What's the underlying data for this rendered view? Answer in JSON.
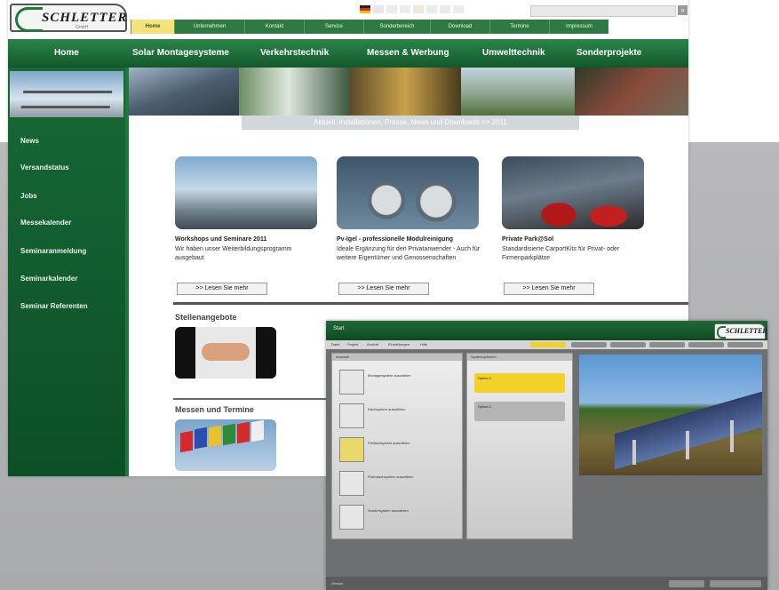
{
  "website": {
    "logo": {
      "name": "SCHLETTER",
      "sub": "GmbH"
    },
    "top_tabs": [
      "Home",
      "Unternehmen",
      "Kontakt",
      "Service",
      "Sonderbereich",
      "Download",
      "Termine",
      "Impressum"
    ],
    "main_nav": [
      "Home",
      "Solar Montagesysteme",
      "Verkehrstechnik",
      "Messen & Werbung",
      "Umwelttechnik",
      "Sonderprojekte"
    ],
    "sidebar": [
      "News",
      "Versandstatus",
      "Jobs",
      "Messekalender",
      "Seminaranmeldung",
      "Seminarkalender",
      "Seminar Referenten"
    ],
    "banner_caption": "Aktuell: Installationen, Presse, News und Downloads >> 2011",
    "cards": [
      {
        "title": "Workshops und Seminare 2011",
        "desc": "Wir haben unser Weiterbildungsprogramm ausgebaut",
        "more": ">> Lesen Sie mehr"
      },
      {
        "title": "Pv-Igel - professionelle Modulreinigung",
        "desc": "Ideale Ergänzung für den Privatanwender - Auch für weitere Eigentümer und Genossenschaften",
        "more": ">> Lesen Sie mehr"
      },
      {
        "title": "Private Park@Sol",
        "desc": "Standardisierte CarportKits für Privat- oder Firmenparkplätze",
        "more": ">> Lesen Sie mehr"
      }
    ],
    "section_jobs": "Stellenangebote",
    "section_fairs": "Messen und Termine"
  },
  "app": {
    "title": "Start",
    "logo": "SCHLETTER",
    "menu": [
      "Datei",
      "Projekt",
      "Ansicht",
      "Einstellungen",
      "Hilfe"
    ],
    "tools_header": "Auswahl",
    "tools": [
      {
        "label": "Montagesystem auswählen"
      },
      {
        "label": "Dachsystem auswählen"
      },
      {
        "label": "Freilandsystem auswählen"
      },
      {
        "label": "Flachdachsystem auswählen"
      },
      {
        "label": "Sondersystem auswählen"
      }
    ],
    "options_header": "Systemoptionen",
    "options": [
      {
        "label": "Option 1"
      },
      {
        "label": "Option 2"
      }
    ],
    "footer_left": "Version",
    "colors": {
      "accent": "#f1d12a",
      "green": "#1b7a3a"
    }
  }
}
